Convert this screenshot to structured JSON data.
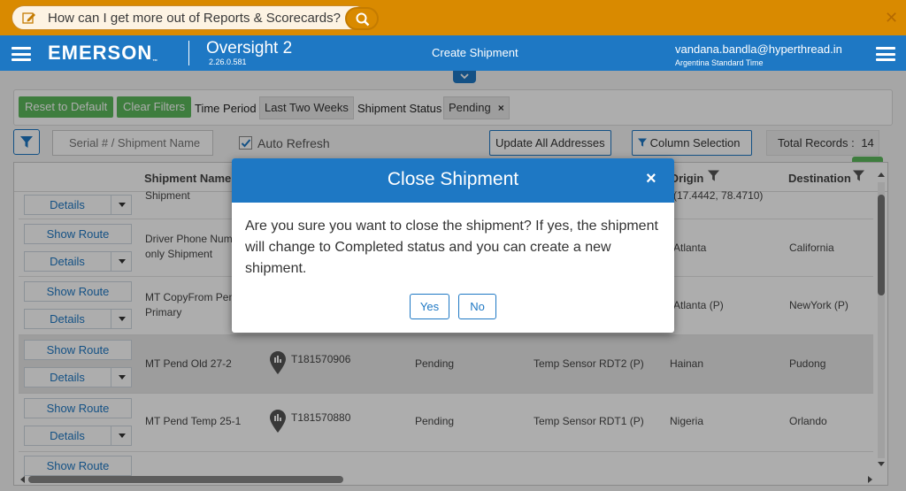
{
  "search": {
    "placeholder": "How can I get more out of Reports & Scorecards?"
  },
  "header": {
    "logo": "EMERSON",
    "app_name": "Oversight 2",
    "version": "2.26.0.581",
    "page_title": "Create Shipment",
    "user_email": "vandana.bandla@hyperthread.in",
    "timezone": "Argentina Standard Time"
  },
  "filters": {
    "reset_label": "Reset to Default",
    "clear_label": "Clear Filters",
    "time_period_label": "Time Period",
    "time_period_value": "Last Two Weeks",
    "status_label": "Shipment Status",
    "status_value": "Pending",
    "status_remove": "×"
  },
  "toolbar": {
    "serial_placeholder": "Serial # / Shipment Name",
    "auto_refresh_label": "Auto Refresh",
    "auto_refresh_checked": true,
    "update_all_label": "Update All Addresses",
    "column_selection_label": "Column Selection",
    "total_records_label": "Total Records :",
    "total_records_value": "14"
  },
  "grid": {
    "headers": {
      "shipment_name": "Shipment Name",
      "origin": "Origin",
      "destination": "Destination"
    },
    "actions": {
      "show_route": "Show Route",
      "details": "Details"
    },
    "partial_top": {
      "name": "Shipment",
      "origin": "(17.4442, 78.4710)"
    },
    "rows": [
      {
        "name_line1": "Driver Phone Numb",
        "name_line2": "only Shipment",
        "serial": "",
        "status": "",
        "device": "",
        "origin": "Atlanta",
        "destination": "California"
      },
      {
        "name_line1": "MT CopyFrom Pend",
        "name_line2": "Primary",
        "serial": "",
        "status": "",
        "device": "",
        "origin": "Atlanta (P)",
        "destination": "NewYork (P)"
      },
      {
        "name_line1": "MT Pend Old 27-2",
        "name_line2": "",
        "serial": "T181570906",
        "status": "Pending",
        "device": "Temp Sensor RDT2 (P)",
        "origin": "Hainan",
        "destination": "Pudong"
      },
      {
        "name_line1": "MT Pend Temp 25-1",
        "name_line2": "",
        "serial": "T181570880",
        "status": "Pending",
        "device": "Temp Sensor RDT1 (P)",
        "origin": "Nigeria",
        "destination": "Orlando"
      }
    ]
  },
  "dialog": {
    "title": "Close Shipment",
    "close": "×",
    "message": "Are you sure you want to close the shipment? If yes, the shipment will change to Completed status and you can create a new shipment.",
    "yes_label": "Yes",
    "no_label": "No"
  },
  "colors": {
    "brand_blue": "#1e78c4",
    "accent_orange": "#d98a00",
    "green": "#5cb85c"
  }
}
